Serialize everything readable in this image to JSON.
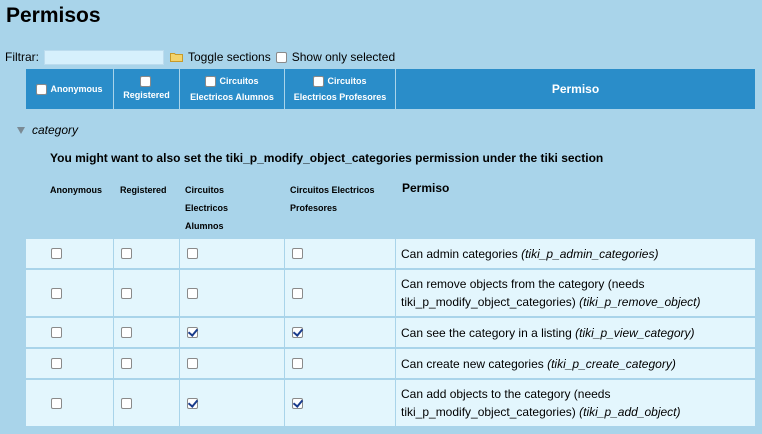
{
  "page": {
    "title": "Permisos"
  },
  "filter": {
    "label": "Filtrar:",
    "value": "",
    "toggle_sections": "Toggle sections",
    "show_only_selected": "Show only selected"
  },
  "header": {
    "groups": [
      "Anonymous",
      "Registered",
      "Circuitos Electricos Alumnos",
      "Circuitos Electricos Profesores"
    ],
    "permission": "Permiso"
  },
  "section": {
    "name": "category",
    "note": "You might want to also set the tiki_p_modify_object_categories permission under the tiki section",
    "subheader": {
      "anonymous": "Anonymous",
      "registered": "Registered",
      "alumnos": "Circuitos Electricos Alumnos",
      "profesores": "Circuitos Electricos Profesores",
      "permission": "Permiso"
    },
    "rows": [
      {
        "description": "Can admin categories",
        "code": "(tiki_p_admin_categories)",
        "checks": [
          false,
          false,
          false,
          false
        ]
      },
      {
        "description": "Can remove objects from the category (needs tiki_p_modify_object_categories)",
        "code": "(tiki_p_remove_object)",
        "checks": [
          false,
          false,
          false,
          false
        ]
      },
      {
        "description": "Can see the category in a listing",
        "code": "(tiki_p_view_category)",
        "checks": [
          false,
          false,
          true,
          true
        ]
      },
      {
        "description": "Can create new categories",
        "code": "(tiki_p_create_category)",
        "checks": [
          false,
          false,
          false,
          false
        ]
      },
      {
        "description": "Can add objects to the category (needs tiki_p_modify_object_categories)",
        "code": "(tiki_p_add_object)",
        "checks": [
          false,
          false,
          true,
          true
        ]
      }
    ]
  }
}
